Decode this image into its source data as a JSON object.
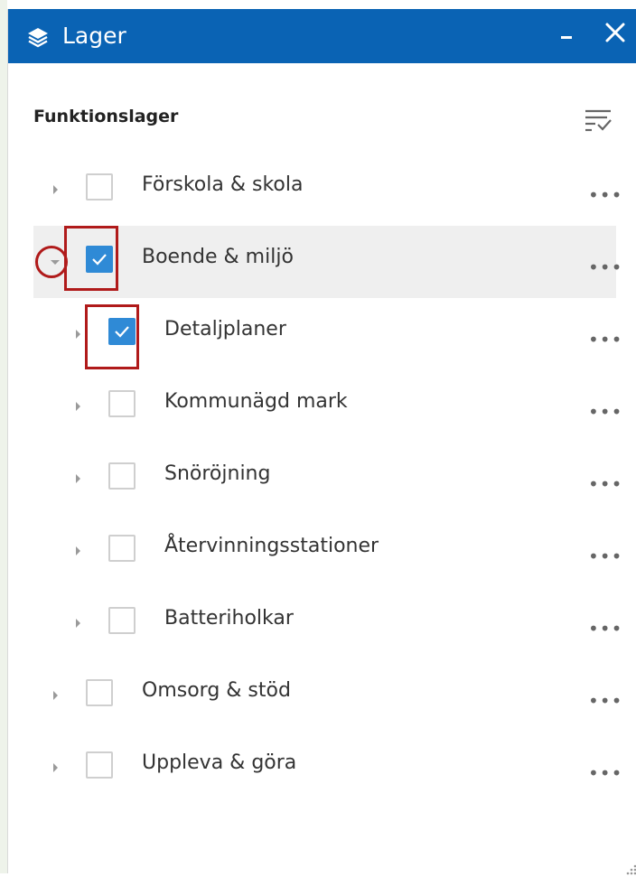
{
  "panel": {
    "title": "Lager",
    "header_color": "#0a63b4",
    "icons": [
      "layers-icon",
      "minimize-icon",
      "close-icon",
      "filter-list-icon",
      "resize-grip-icon"
    ]
  },
  "section": {
    "title": "Funktionslager"
  },
  "layers": [
    {
      "label": "Förskola & skola",
      "checked": false,
      "expanded": false,
      "level": 0
    },
    {
      "label": "Boende & miljö",
      "checked": true,
      "expanded": true,
      "level": 0
    },
    {
      "label": "Detaljplaner",
      "checked": true,
      "expanded": false,
      "level": 1
    },
    {
      "label": "Kommunägd mark",
      "checked": false,
      "expanded": false,
      "level": 1
    },
    {
      "label": "Snöröjning",
      "checked": false,
      "expanded": false,
      "level": 1
    },
    {
      "label": "Återvinningsstationer",
      "checked": false,
      "expanded": false,
      "level": 1
    },
    {
      "label": "Batteriholkar",
      "checked": false,
      "expanded": false,
      "level": 1
    },
    {
      "label": "Omsorg & stöd",
      "checked": false,
      "expanded": false,
      "level": 0
    },
    {
      "label": "Uppleva & göra",
      "checked": false,
      "expanded": false,
      "level": 0
    }
  ],
  "more_glyph": "•••",
  "colors": {
    "checked": "#2f8ad6",
    "annotation": "#b01a1a",
    "selected_row": "#efefef"
  }
}
